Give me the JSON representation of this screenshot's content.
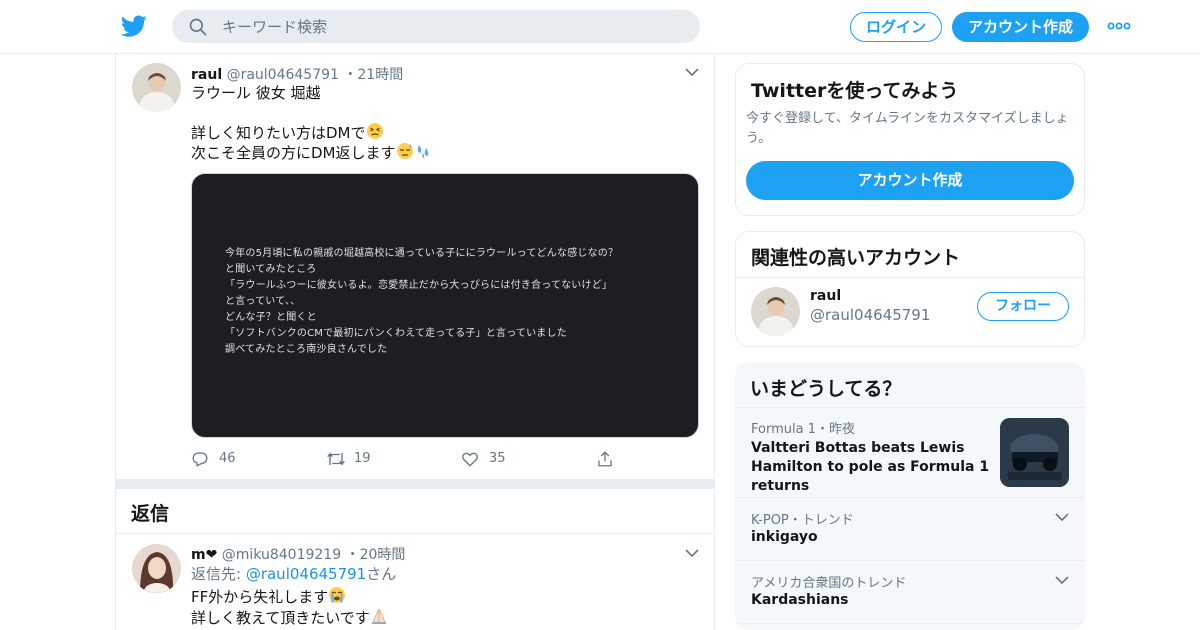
{
  "header": {
    "search_placeholder": "キーワード検索",
    "login_label": "ログイン",
    "signup_label": "アカウント作成",
    "brand_color": "#1da1f2"
  },
  "tweet": {
    "name": "raul",
    "handle": "@raul04645791",
    "time": "21時間",
    "text_line1": "ラウール 彼女 堀越",
    "text_line2": "詳しく知りたい方はDMで",
    "text_line3": "次こそ全員の方にDM返します",
    "media_lines": [
      "今年の5月頃に私の親戚の堀越高校に通っている子ににラウールってどんな感じなの？",
      "と聞いてみたところ",
      "「ラウールふつーに彼女いるよ。恋愛禁止だから大っぴらには付き合ってないけど」",
      "と言っていて、、",
      "どんな子？と聞くと",
      "「ソフトバンクのCMで最初にパンくわえて走ってる子」と言っていました",
      "調べてみたところ南沙良さんでした"
    ],
    "replies_count": "46",
    "retweets_count": "19",
    "likes_count": "35"
  },
  "replies_section": {
    "title": "返信"
  },
  "reply": {
    "name": "m❤",
    "handle": "@miku84019219",
    "time": "20時間",
    "reply_to_prefix": "返信先: ",
    "reply_to_handle": "@raul04645791",
    "reply_to_suffix": "さん",
    "text_line1": "FF外から失礼します",
    "text_line2": "詳しく教えて頂きたいです"
  },
  "signup_card": {
    "title": "Twitterを使ってみよう",
    "description": "今すぐ登録して、タイムラインをカスタマイズしましょう。",
    "button_label": "アカウント作成"
  },
  "related_card": {
    "title": "関連性の高いアカウント",
    "account_name": "raul",
    "account_handle": "@raul04645791",
    "follow_label": "フォロー"
  },
  "trends_card": {
    "title": "いまどうしてる？",
    "items": [
      {
        "meta": "Formula 1・昨夜",
        "title": "Valtteri Bottas beats Lewis Hamilton to pole as Formula 1 returns"
      },
      {
        "meta": "K-POP・トレンド",
        "title": "inkigayo"
      },
      {
        "meta": "アメリカ合衆国のトレンド",
        "title": "Kardashians"
      }
    ]
  }
}
